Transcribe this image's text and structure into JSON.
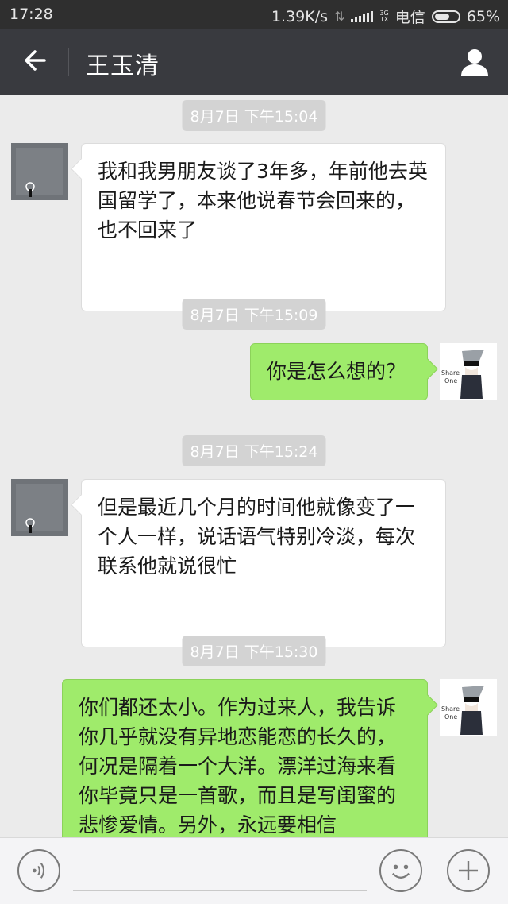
{
  "status_bar": {
    "time": "17:28",
    "speed": "1.39K/s",
    "network_top": "3G",
    "network_bottom": "1X",
    "carrier": "电信",
    "battery": "65%",
    "battery_level": 0.65
  },
  "nav": {
    "title": "王玉清",
    "back_icon": "back-arrow-icon",
    "profile_icon": "person-icon"
  },
  "messages": [
    {
      "type": "timestamp",
      "text": "8月7日 下午15:04"
    },
    {
      "type": "incoming",
      "text": "我和我男朋友谈了3年多，年前他去英国留学了，本来他说春节会回来的，也不回来了"
    },
    {
      "type": "timestamp",
      "text": "8月7日 下午15:09"
    },
    {
      "type": "outgoing",
      "text": "你是怎么想的？"
    },
    {
      "type": "timestamp",
      "text": "8月7日 下午15:24"
    },
    {
      "type": "incoming",
      "text": "但是最近几个月的时间他就像变了一个人一样，说话语气特别冷淡，每次联系他就说很忙"
    },
    {
      "type": "timestamp",
      "text": "8月7日 下午15:30"
    },
    {
      "type": "outgoing",
      "text": "你们都还太小。作为过来人，我告诉你几乎就没有异地恋能恋的长久的，何况是隔着一个大洋。漂洋过海来看你毕竟只是一首歌，而且是写闺蜜的悲惨爱情。另外，永远要相信"
    }
  ],
  "avatar_labels": {
    "line1": "Share",
    "line2": "One"
  },
  "input_bar": {
    "voice_icon": "voice-icon",
    "emoji_icon": "emoji-icon",
    "plus_icon": "plus-icon"
  },
  "colors": {
    "nav_bg": "#393a3f",
    "chat_bg": "#ebebeb",
    "outgoing_bubble": "#9feb6b",
    "incoming_bubble": "#ffffff"
  }
}
